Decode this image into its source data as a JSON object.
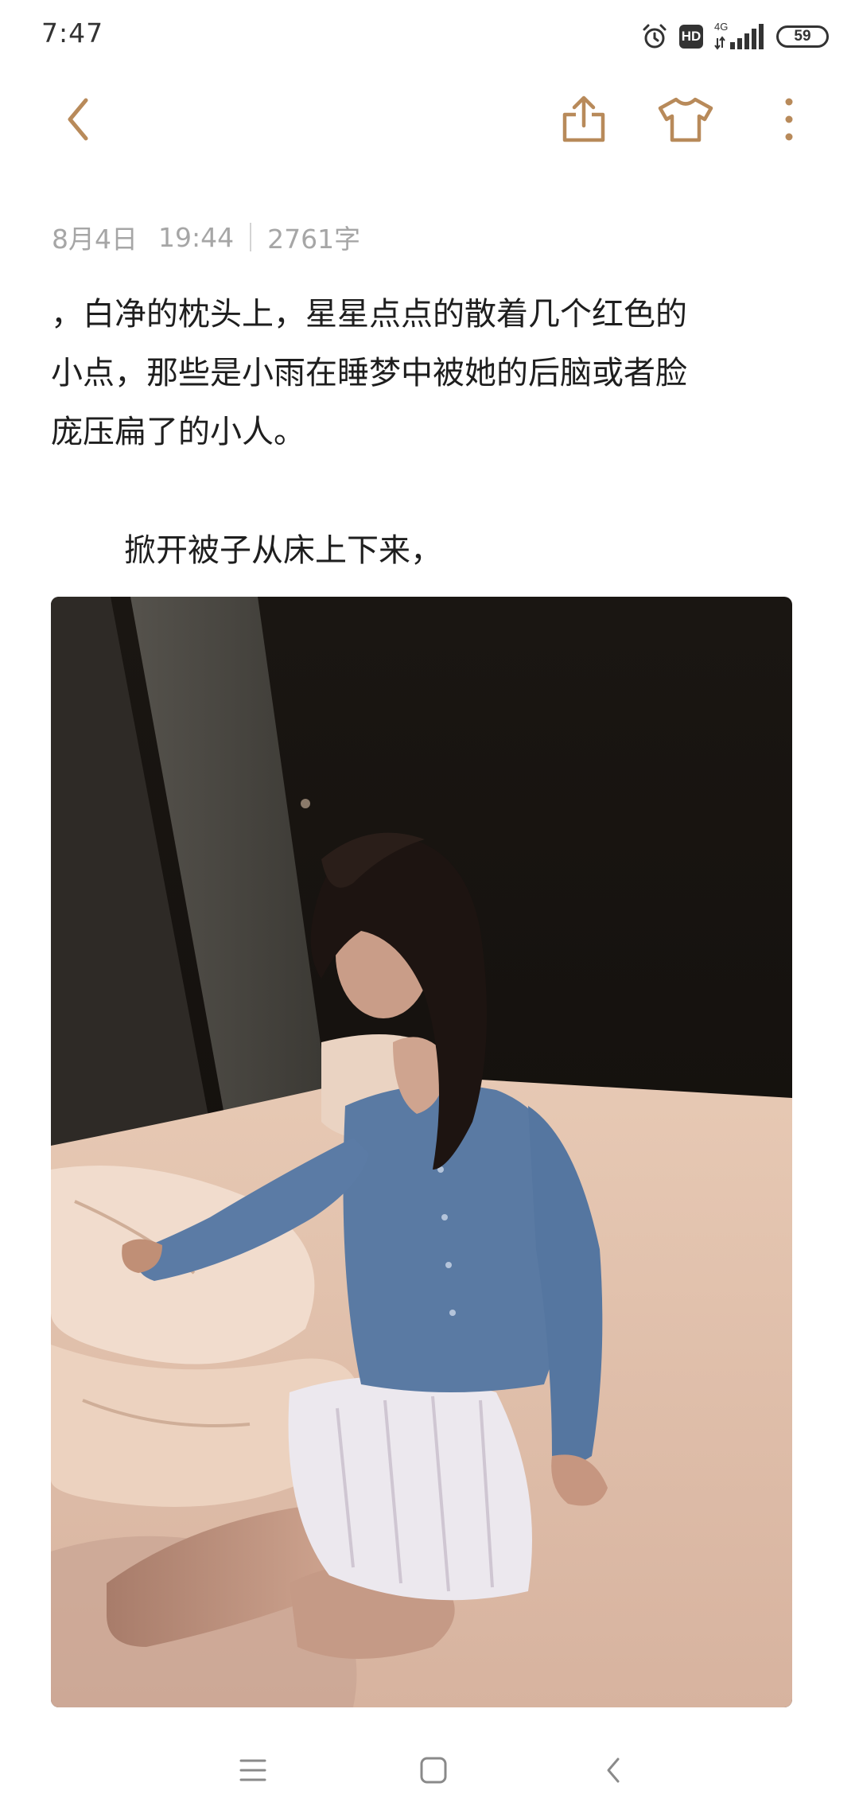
{
  "status_bar": {
    "time": "7:47",
    "hd_label": "HD",
    "network_label": "4G",
    "battery": "59"
  },
  "toolbar": {
    "back_icon": "chevron-left-icon",
    "share_icon": "share-icon",
    "theme_icon": "tshirt-icon",
    "more_icon": "more-vertical-icon",
    "accent_color": "#b88a5a"
  },
  "note": {
    "date": "8月4日",
    "time": "19:44",
    "word_count": "2761字",
    "paragraphs": [
      "，白净的枕头上，星星点点的散着几个红色的\n小点，那些是小雨在睡梦中被她的后脑或者脸\n庞压扁了的小人。",
      "掀开被子从床上下来，"
    ]
  },
  "photo": {
    "icon": "photo-image"
  },
  "nav_bar": {
    "menu_icon": "menu-icon",
    "home_icon": "home-square-icon",
    "back_icon": "back-chevron-icon"
  }
}
